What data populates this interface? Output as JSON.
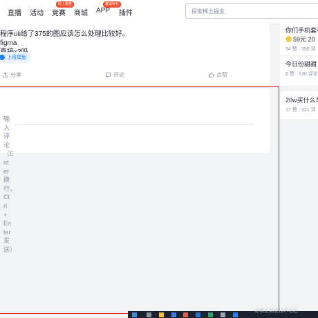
{
  "nav": {
    "items": [
      {
        "label": "直播"
      },
      {
        "label": "活动"
      },
      {
        "label": "竞赛",
        "badge": "码上掘金"
      },
      {
        "label": "商城"
      },
      {
        "label": "APP",
        "badge": "邀请有礼"
      },
      {
        "label": "插件"
      }
    ],
    "search_placeholder": "探索稀土掘金"
  },
  "post": {
    "line1": "程序uii给了375的图应该怎么处理比较好。figma",
    "line2": "直接x2吗",
    "circle": "上班摸鱼",
    "share": "分享",
    "comment": "评论",
    "like": "点赞"
  },
  "comment_box": {
    "placeholder": "输入评论（Enter换行，Ctrl + Enter发送）"
  },
  "sidebar": {
    "cards": [
      {
        "title": "你们手机套有",
        "sub": "59元 20",
        "meta": "34 赞 · 350 评"
      },
      {
        "title": "今日份甜甜",
        "meta": "6 赞 · 130 评论"
      },
      {
        "title": "20w买什么车",
        "meta": "17 赞 · 321 评"
      }
    ]
  },
  "watermark": "@稀土掘金技术社区",
  "colors": {
    "accent": "#1e80ff",
    "badge": "#ee502f",
    "highlight": "#e02020"
  }
}
